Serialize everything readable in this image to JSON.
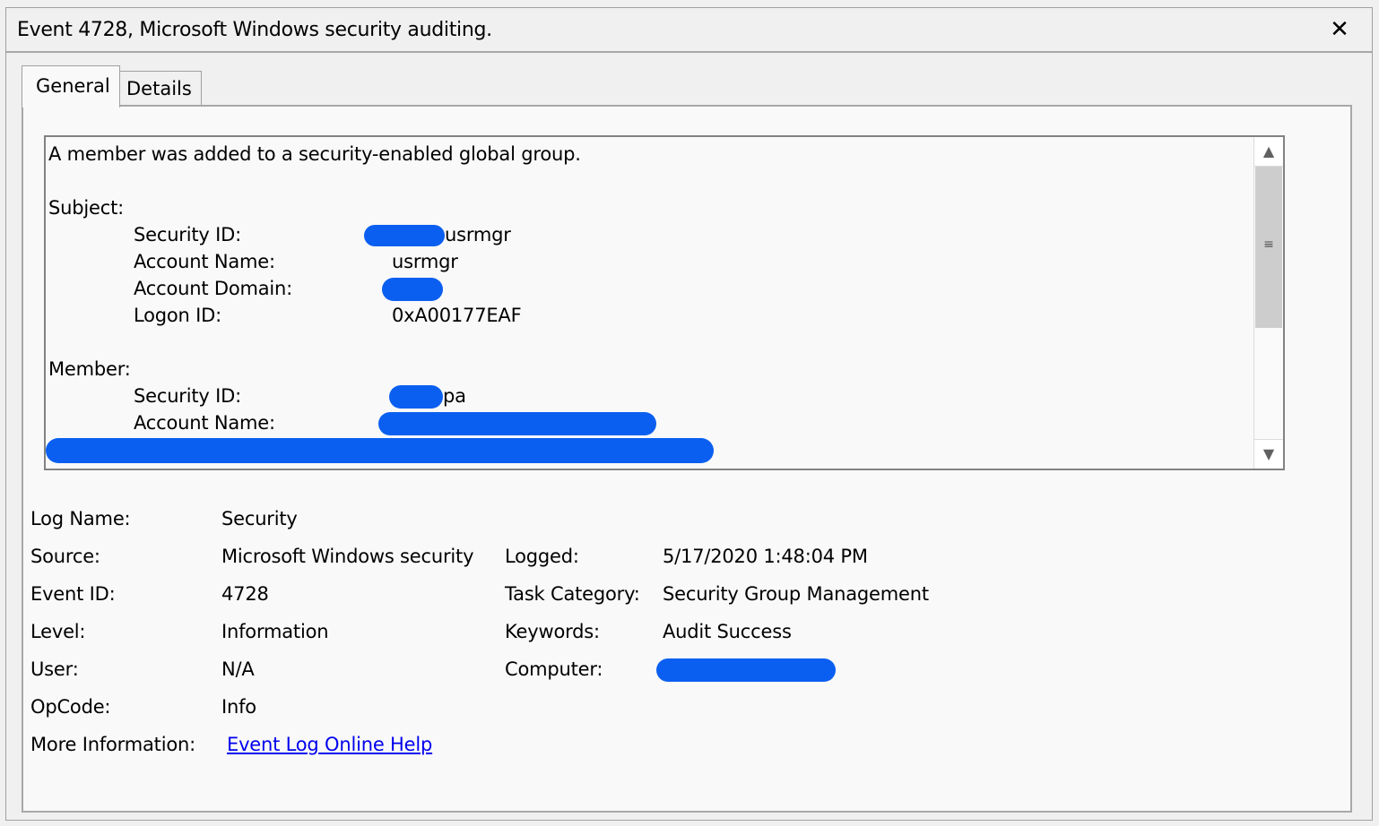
{
  "window": {
    "title": "Event 4728, Microsoft Windows security auditing.",
    "close_label": "✕"
  },
  "tabs": [
    {
      "label": "General",
      "active": true
    },
    {
      "label": "Details",
      "active": false
    }
  ],
  "description": {
    "summary": "A member was added to a security-enabled global group.",
    "subject_header": "Subject:",
    "subject": {
      "security_id_label": "Security ID:",
      "security_id_value": "usrmgr",
      "account_name_label": "Account Name:",
      "account_name_value": "usrmgr",
      "account_domain_label": "Account Domain:",
      "logon_id_label": "Logon ID:",
      "logon_id_value": "0xA00177EAF"
    },
    "member_header": "Member:",
    "member": {
      "security_id_label": "Security ID:",
      "security_id_value": "pa",
      "account_name_label": "Account Name:"
    },
    "redaction_color": "#0b5ff0"
  },
  "scrollbar": {
    "up_icon": "▲",
    "down_icon": "▼",
    "grip": "≡"
  },
  "properties": {
    "log_name_label": "Log Name:",
    "log_name_value": "Security",
    "source_label": "Source:",
    "source_value": "Microsoft Windows security",
    "logged_label": "Logged:",
    "logged_value": "5/17/2020 1:48:04 PM",
    "event_id_label": "Event ID:",
    "event_id_value": "4728",
    "task_category_label": "Task Category:",
    "task_category_value": "Security Group Management",
    "level_label": "Level:",
    "level_value": "Information",
    "keywords_label": "Keywords:",
    "keywords_value": "Audit Success",
    "user_label": "User:",
    "user_value": "N/A",
    "computer_label": "Computer:",
    "opcode_label": "OpCode:",
    "opcode_value": "Info",
    "more_info_label": "More Information:",
    "more_info_link": "Event Log Online Help"
  }
}
